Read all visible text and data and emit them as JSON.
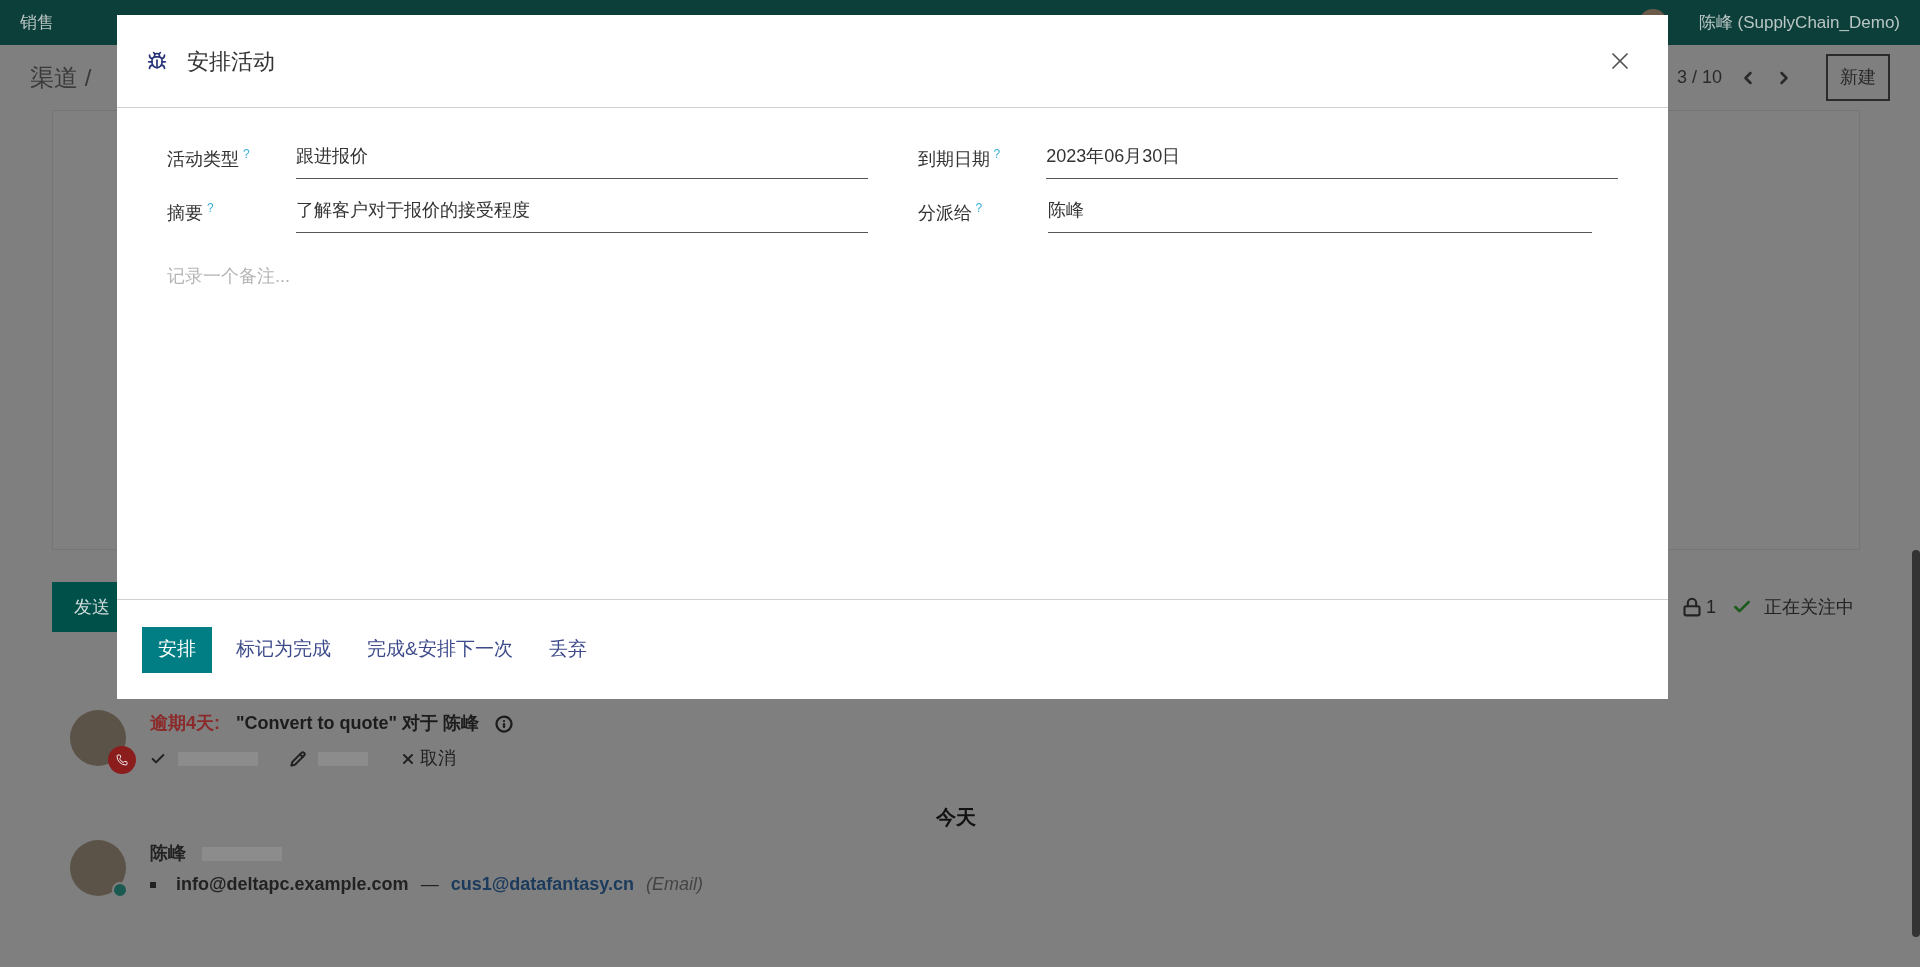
{
  "navbar": {
    "menu": [
      "销售"
    ],
    "user": "陈峰 (SupplyChain_Demo)"
  },
  "control_panel": {
    "breadcrumb": "渠道 /",
    "pager": "3 / 10",
    "new_button": "新建"
  },
  "chatter": {
    "send_button": "发送",
    "followers_count": "1",
    "following": "正在关注中"
  },
  "activity": {
    "overdue": "逾期4天:",
    "summary": "\"Convert to quote\" 对于 陈峰",
    "actions": [
      {
        "kind": "cancel",
        "label": "取消"
      }
    ]
  },
  "separator": "今天",
  "message": {
    "author": "陈峰",
    "from": "info@deltapc.example.com",
    "dash": "—",
    "to": "cus1@datafantasy.cn",
    "type": "(Email)"
  },
  "dialog": {
    "title": "安排活动",
    "fields": [
      {
        "label": "活动类型",
        "value": "跟进报价"
      },
      {
        "label": "到期日期",
        "value": "2023年06月30日"
      },
      {
        "label": "摘要",
        "value": "了解客户对于报价的接受程度"
      },
      {
        "label": "分派给",
        "value": "陈峰"
      }
    ],
    "help_mark": "?",
    "note_placeholder": "记录一个备注...",
    "buttons": [
      {
        "label": "安排",
        "kind": "primary"
      },
      {
        "label": "标记为完成",
        "kind": "link"
      },
      {
        "label": "完成&安排下一次",
        "kind": "link"
      },
      {
        "label": "丢弃",
        "kind": "link"
      }
    ]
  }
}
